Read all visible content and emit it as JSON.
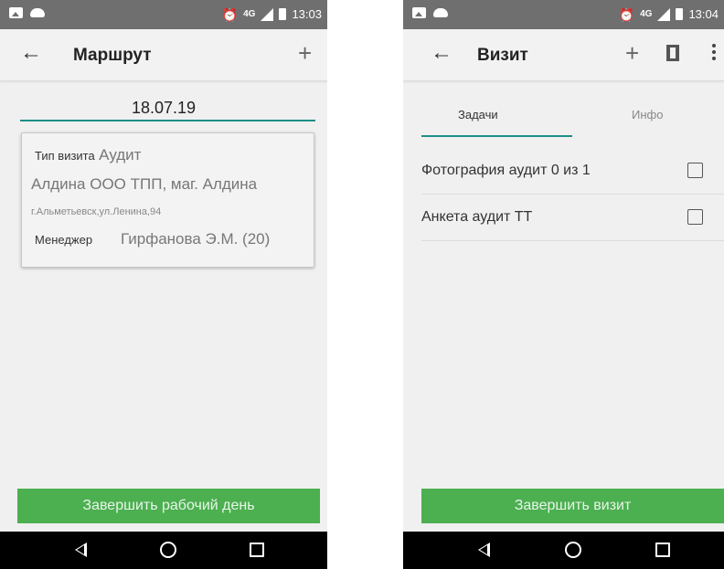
{
  "screen1": {
    "status": {
      "time": "13:03",
      "network": "4G"
    },
    "appbar": {
      "title": "Маршрут",
      "add": "+"
    },
    "date": "18.07.19",
    "card": {
      "visit_type_label": "Тип визита",
      "visit_type_value": "Аудит",
      "store_name": "Алдина ООО ТПП, маг. Алдина",
      "address": "г.Альметьевск,ул.Ленина,94",
      "manager_label": "Менеджер",
      "manager_value": "Гирфанова Э.М. (20)"
    },
    "finish_button": "Завершить рабочий день"
  },
  "screen2": {
    "status": {
      "time": "13:04",
      "network": "4G"
    },
    "appbar": {
      "title": "Визит",
      "add": "+"
    },
    "tabs": [
      {
        "label": "Задачи",
        "active": true
      },
      {
        "label": "Инфо",
        "active": false
      }
    ],
    "tasks": [
      {
        "label": "Фотография аудит 0 из 1",
        "checked": false
      },
      {
        "label": "Анкета аудит ТТ",
        "checked": false
      }
    ],
    "finish_button": "Завершить визит"
  },
  "colors": {
    "accent": "#1b8f86",
    "button": "#4caf50",
    "statusbar": "#6f6f6f",
    "navbar": "#000000"
  },
  "icons": [
    "back-arrow-icon",
    "add-icon",
    "map-icon",
    "more-vert-icon",
    "checkbox-icon",
    "nav-back-icon",
    "nav-home-icon",
    "nav-recent-icon"
  ]
}
